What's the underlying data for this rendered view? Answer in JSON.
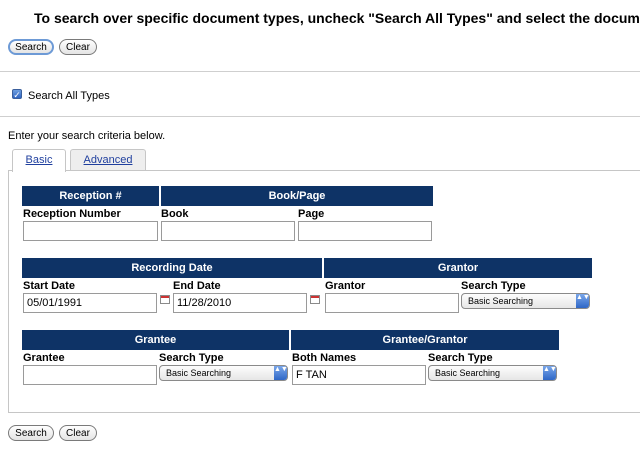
{
  "instructions": "To search over specific document types, uncheck \"Search All Types\" and select the document",
  "buttons": {
    "search": "Search",
    "clear": "Clear"
  },
  "search_all": {
    "label": "Search All Types",
    "checked": true,
    "mark": "✓"
  },
  "criteria_text": "Enter your search criteria below.",
  "tabs": {
    "basic": "Basic",
    "advanced": "Advanced"
  },
  "sections": {
    "reception": {
      "header": "Reception #",
      "field_label": "Reception Number",
      "value": ""
    },
    "book_page": {
      "header": "Book/Page",
      "book_label": "Book",
      "book_value": "",
      "page_label": "Page",
      "page_value": ""
    },
    "recording_date": {
      "header": "Recording Date",
      "start_label": "Start Date",
      "start_value": "05/01/1991",
      "end_label": "End Date",
      "end_value": "11/28/2010"
    },
    "grantor": {
      "header": "Grantor",
      "field_label": "Grantor",
      "value": "",
      "type_label": "Search Type",
      "type_value": "Basic Searching"
    },
    "grantee": {
      "header": "Grantee",
      "field_label": "Grantee",
      "value": "",
      "type_label": "Search Type",
      "type_value": "Basic Searching"
    },
    "grantee_grantor": {
      "header": "Grantee/Grantor",
      "field_label": "Both Names",
      "value": "F TAN",
      "type_label": "Search Type",
      "type_value": "Basic Searching"
    }
  },
  "select_arrow": "▲▼"
}
